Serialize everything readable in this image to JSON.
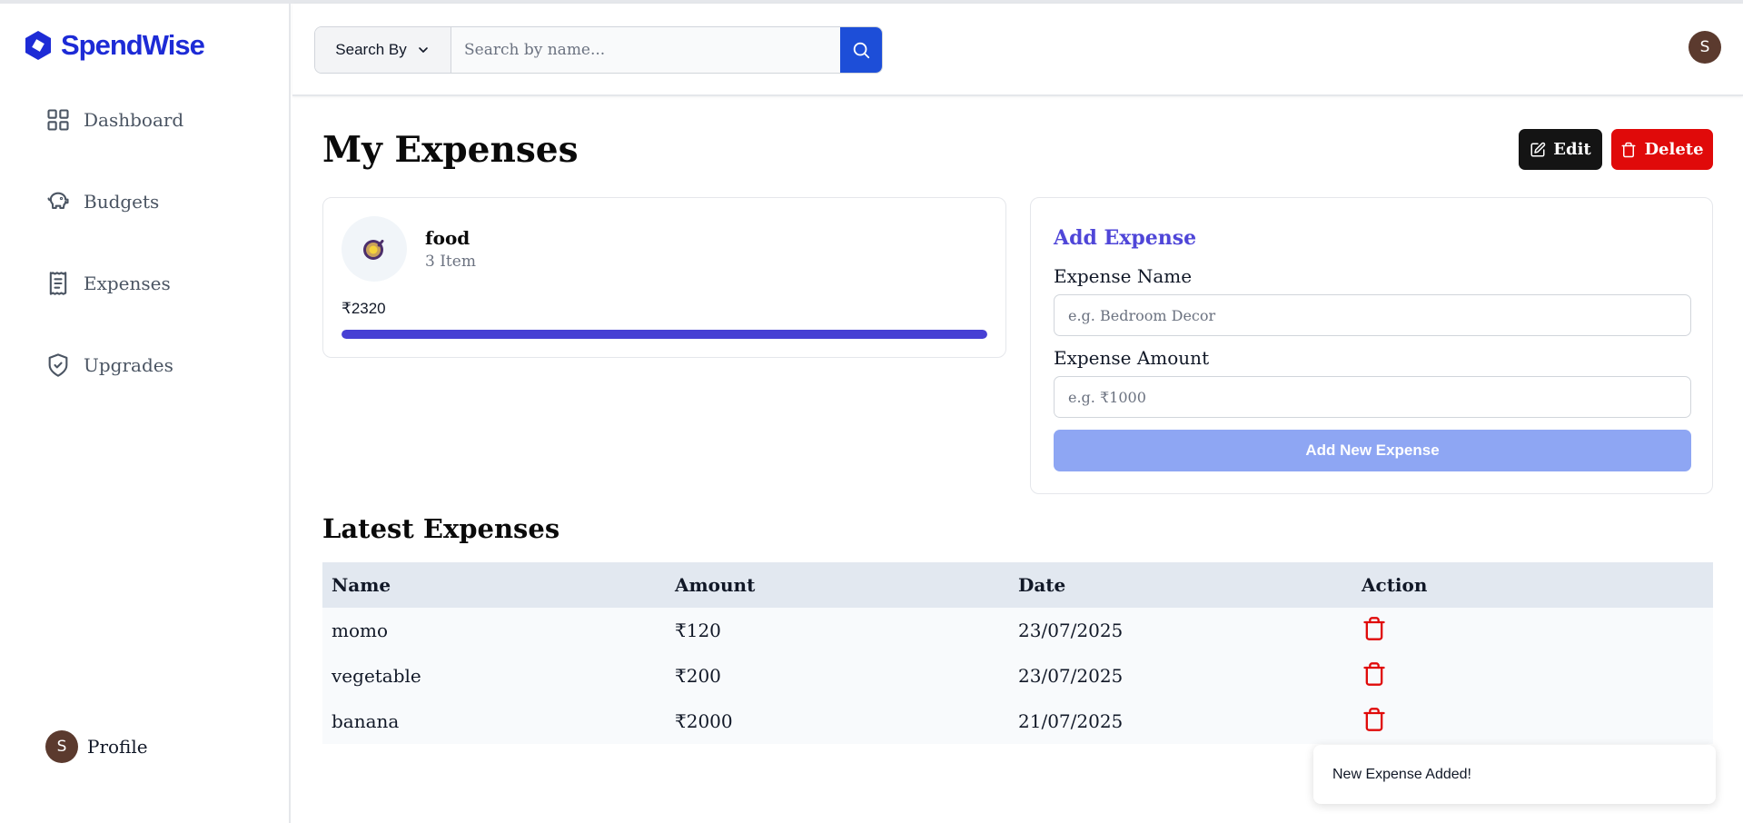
{
  "app": {
    "name": "SpendWise",
    "brand_color": "#1d2bd6"
  },
  "sidebar": {
    "items": [
      {
        "label": "Dashboard",
        "icon": "layout-grid-icon"
      },
      {
        "label": "Budgets",
        "icon": "piggy-bank-icon"
      },
      {
        "label": "Expenses",
        "icon": "receipt-icon"
      },
      {
        "label": "Upgrades",
        "icon": "shield-check-icon"
      }
    ],
    "profile": {
      "label": "Profile",
      "avatar_letter": "S"
    }
  },
  "header": {
    "search_by_label": "Search By",
    "search_placeholder": "Search by name...",
    "avatar_letter": "S"
  },
  "main": {
    "title": "My Expenses",
    "edit_label": "Edit",
    "delete_label": "Delete",
    "budget": {
      "emoji": "🍳",
      "name": "food",
      "items": "3 Item",
      "amount": "₹2320",
      "progress_fraction": 1.0
    },
    "add_expense": {
      "title": "Add Expense",
      "name_label": "Expense Name",
      "name_placeholder": "e.g. Bedroom Decor",
      "amount_label": "Expense Amount",
      "amount_placeholder": "e.g. ₹1000",
      "button_label": "Add New Expense"
    },
    "latest": {
      "title": "Latest Expenses",
      "columns": [
        "Name",
        "Amount",
        "Date",
        "Action"
      ],
      "rows": [
        {
          "name": "momo",
          "amount": "₹120",
          "date": "23/07/2025"
        },
        {
          "name": "vegetable",
          "amount": "₹200",
          "date": "23/07/2025"
        },
        {
          "name": "banana",
          "amount": "₹2000",
          "date": "21/07/2025"
        }
      ]
    }
  },
  "toast": {
    "message": "New Expense Added!"
  },
  "colors": {
    "accent": "#4740d4",
    "danger": "#e00a0a",
    "search_button": "#1d4ed8",
    "add_button_disabled": "#8ea6f3"
  }
}
